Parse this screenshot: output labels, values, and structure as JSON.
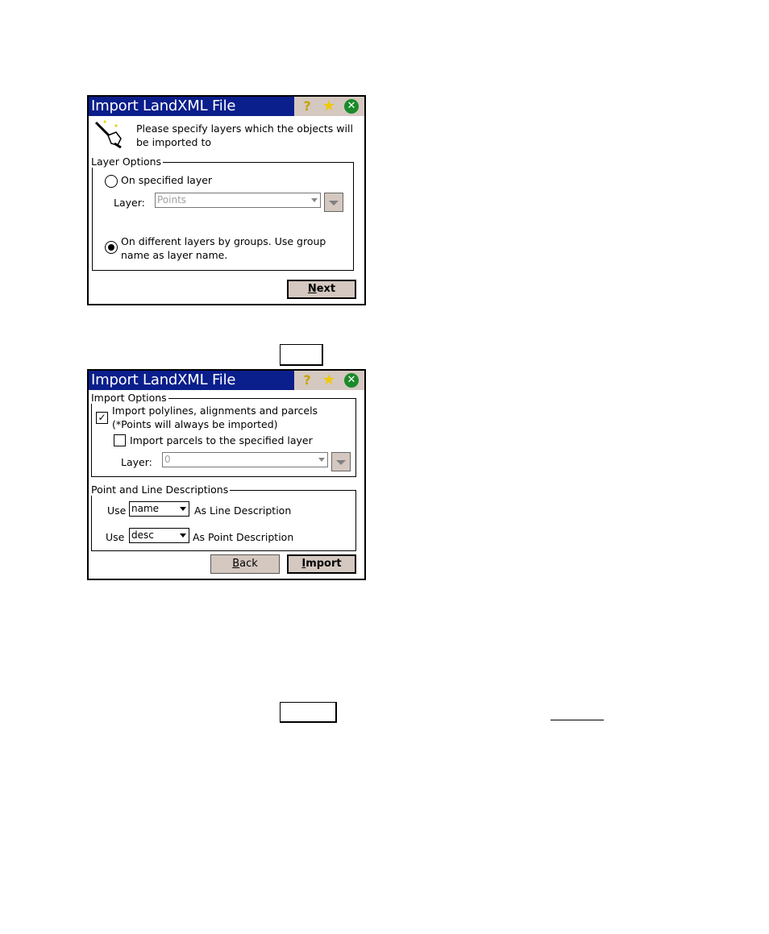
{
  "dialog1": {
    "title": "Import LandXML File",
    "title_icons": [
      "help-icon",
      "star-icon",
      "close-icon"
    ],
    "intro_text_line1": "Please specify layers which the objects will",
    "intro_text_line2": "be imported to",
    "group_label": "Layer Options",
    "radio_specified_label": "On specified layer",
    "radio_specified_checked": false,
    "layer_label": "Layer:",
    "layer_value": "Points",
    "radio_groups_label_line1": "On different layers by groups. Use group",
    "radio_groups_label_line2": "name as layer name.",
    "radio_groups_checked": true,
    "next_button": "Next",
    "next_button_accel": "N"
  },
  "dialog2": {
    "title": "Import LandXML File",
    "import_group_label": "Import Options",
    "import_polylines_label_line1": "Import polylines, alignments and parcels",
    "import_polylines_label_line2": "(*Points will always be imported)",
    "import_polylines_checked": true,
    "import_parcels_label": "Import parcels to the specified layer",
    "import_parcels_checked": false,
    "layer_label": "Layer:",
    "layer_value": "0",
    "desc_group_label": "Point and Line Descriptions",
    "use_label": "Use",
    "line_desc_value": "name",
    "line_desc_label": "As Line Description",
    "point_desc_value": "desc",
    "point_desc_label": "As Point Description",
    "back_button": "Back",
    "import_button": "Import"
  }
}
